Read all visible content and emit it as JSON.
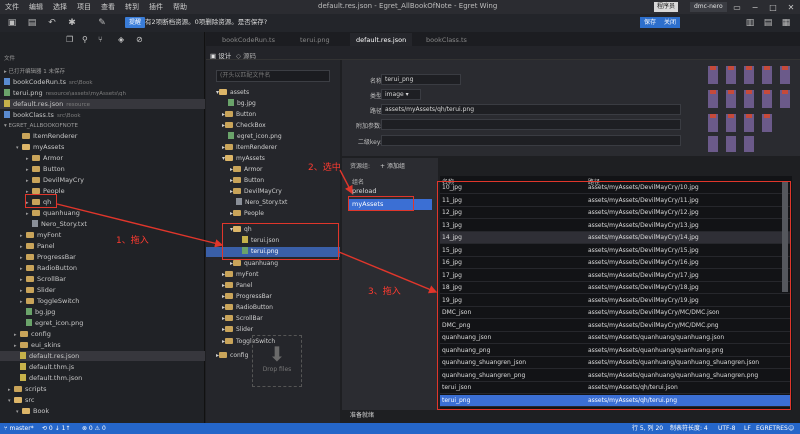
{
  "app": {
    "title": "default.res.json - Egret_AllBookOfNote - Egret Wing",
    "menu": [
      "文件",
      "编辑",
      "选择",
      "项目",
      "查看",
      "转到",
      "插件",
      "帮助"
    ],
    "window_controls": [
      "minimize-icon",
      "maximize-icon",
      "close-icon"
    ],
    "program_label": "程序员",
    "user": "dmc-nero"
  },
  "toolbar": {
    "prompt_badge": "提醒",
    "prompt_text": "有2项断档资源。0项删除资源。是否保存?",
    "save_label": "保存",
    "close_label": "关闭"
  },
  "sidebar": {
    "section_files": "文件",
    "section_open": "▸ 已打开编辑器 1 未保存",
    "open_editors": [
      {
        "name": "bookCodeRun.ts",
        "hint": "src\\Book"
      },
      {
        "name": "terui.png",
        "hint": "resource\\assets\\myAssets\\qh"
      },
      {
        "name": "default.res.json",
        "hint": "resource"
      },
      {
        "name": "bookClass.ts",
        "hint": "src\\Book"
      }
    ],
    "project_name": "▾ EGRET_ALLBOOKOFNOTE",
    "tree": [
      "ItemRenderer",
      "myAssets",
      "Armor",
      "Button",
      "DevilMayCry",
      "People",
      "qh",
      "quanhuang",
      "Nero_Story.txt",
      "myFont",
      "Panel",
      "ProgressBar",
      "RadioButton",
      "ScrollBar",
      "Slider",
      "ToggleSwitch",
      "bg.jpg",
      "egret_icon.png",
      "config",
      "eui_skins",
      "default.res.json",
      "default.thm.js",
      "default.thm.json",
      "scripts",
      "src",
      "Book"
    ]
  },
  "editor": {
    "tabs": [
      "bookCodeRun.ts",
      "terui.png",
      "default.res.json",
      "bookClass.ts"
    ],
    "design_label": "设计",
    "source_label": "源码",
    "filter_placeholder": "(开头以匹配文件名",
    "res_tree": [
      "assets",
      "bg.jpg",
      "Button",
      "CheckBox",
      "egret_icon.png",
      "ItemRenderer",
      "myAssets",
      "Armor",
      "Button",
      "DevilMayCry",
      "Nero_Story.txt",
      "People",
      "qh",
      "terui.json",
      "terui.png",
      "quanhuang",
      "myFont",
      "Panel",
      "ProgressBar",
      "RadioButton",
      "ScrollBar",
      "Slider",
      "ToggleSwitch",
      "config"
    ],
    "drop_label": "Drop files"
  },
  "properties": {
    "name_label": "名称:",
    "name_value": "terui_png",
    "type_label": "类型:",
    "type_value": "image",
    "path_label": "路径:",
    "path_value": "assets/myAssets/qh/terui.png",
    "params_label": "附加参数:",
    "params_value": "",
    "key2_label": "二级key:",
    "key2_value": ""
  },
  "groups": {
    "header_label": "资源组:",
    "add_label": "添加组",
    "col_name": "组名",
    "items": [
      "preload",
      "myAssets"
    ]
  },
  "table": {
    "col_name": "名称",
    "col_path": "路径",
    "rows": [
      {
        "name": "10_jpg",
        "path": "assets/myAssets/DevilMayCry/10.jpg"
      },
      {
        "name": "11_jpg",
        "path": "assets/myAssets/DevilMayCry/11.jpg"
      },
      {
        "name": "12_jpg",
        "path": "assets/myAssets/DevilMayCry/12.jpg"
      },
      {
        "name": "13_jpg",
        "path": "assets/myAssets/DevilMayCry/13.jpg"
      },
      {
        "name": "14_jpg",
        "path": "assets/myAssets/DevilMayCry/14.jpg"
      },
      {
        "name": "15_jpg",
        "path": "assets/myAssets/DevilMayCry/15.jpg"
      },
      {
        "name": "16_jpg",
        "path": "assets/myAssets/DevilMayCry/16.jpg"
      },
      {
        "name": "17_jpg",
        "path": "assets/myAssets/DevilMayCry/17.jpg"
      },
      {
        "name": "18_jpg",
        "path": "assets/myAssets/DevilMayCry/18.jpg"
      },
      {
        "name": "19_jpg",
        "path": "assets/myAssets/DevilMayCry/19.jpg"
      },
      {
        "name": "DMC_json",
        "path": "assets/myAssets/DevilMayCry/MC/DMC.json"
      },
      {
        "name": "DMC_png",
        "path": "assets/myAssets/DevilMayCry/MC/DMC.png"
      },
      {
        "name": "quanhuang_json",
        "path": "assets/myAssets/quanhuang/quanhuang.json"
      },
      {
        "name": "quanhuang_png",
        "path": "assets/myAssets/quanhuang/quanhuang.png"
      },
      {
        "name": "quanhuang_shuangren_json",
        "path": "assets/myAssets/quanhuang/quanhuang_shuangren.json"
      },
      {
        "name": "quanhuang_shuangren_png",
        "path": "assets/myAssets/quanhuang/quanhuang_shuangren.png"
      },
      {
        "name": "terui_json",
        "path": "assets/myAssets/qh/terui.json"
      },
      {
        "name": "terui_png",
        "path": "assets/myAssets/qh/terui.png"
      }
    ]
  },
  "annotations": {
    "step1": "1、拖入",
    "step2": "2、选中",
    "step3": "3、拖入"
  },
  "status": {
    "ready": "准备就绪",
    "branch": "master*",
    "sync": "⟲ 0 ↓ 1↑",
    "errors": "⊗ 0 ⚠ 0",
    "cursor": "行 5, 列 20",
    "indent": "制表符长度: 4",
    "encoding": "UTF-8",
    "eol": "LF",
    "lang": "EGRETRES",
    "accent": "#2566c9"
  }
}
